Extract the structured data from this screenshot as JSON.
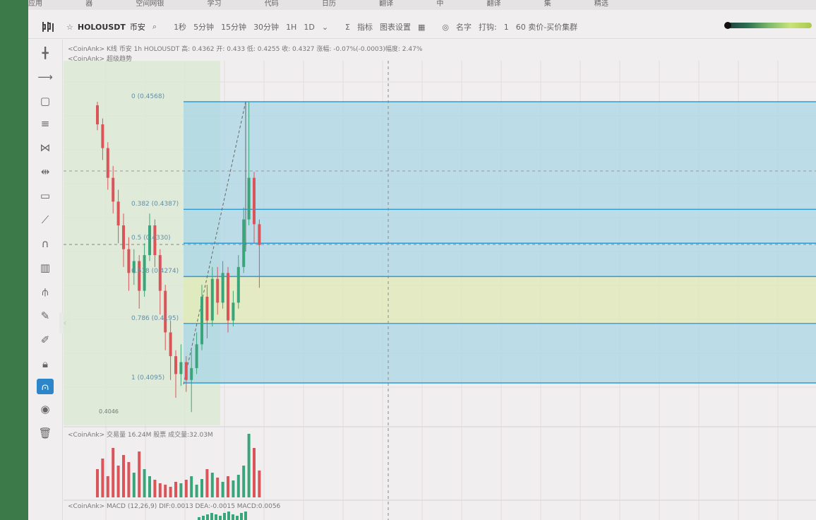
{
  "bookmarks": [
    "应用",
    "器",
    "空间网银",
    "学习",
    "代码",
    "日历",
    "翻译",
    "中",
    "翻译",
    "集",
    "精选"
  ],
  "toolbar": {
    "symbol": "HOLOUSDT",
    "market": "币安",
    "intervals": [
      "1秒",
      "5分钟",
      "15分钟",
      "30分钟",
      "1H",
      "1D"
    ],
    "indicators_label": "指标",
    "chart_settings_label": "图表设置",
    "name_label": "名字",
    "order_label": "打钩:",
    "order_value": "1",
    "price_label": "60 卖价-买价集群"
  },
  "chart_header": {
    "line1": "<CoinAnk> K线  币安 1h HOLOUSDT 高: 0.4362  开: 0.433  低: 0.4255  收: 0.4327 涨幅: -0.07%(-0.0003)幅度: 2.47%",
    "line2": "<CoinAnk> 超级趋势"
  },
  "fib_levels": [
    {
      "label": "0 (0.4568)",
      "price": 0.4568
    },
    {
      "label": "0.382 (0.4387)",
      "price": 0.4387
    },
    {
      "label": "0.5 (0.4330)",
      "price": 0.433
    },
    {
      "label": "0.618 (0.4274)",
      "price": 0.4274
    },
    {
      "label": "0.786 (0.4195)",
      "price": 0.4195
    },
    {
      "label": "1 (0.4095)",
      "price": 0.4095
    }
  ],
  "low_marker": "0.4046",
  "volume": {
    "header": "<CoinAnk> 交易量   16.24M  股票  成交量:32.03M"
  },
  "macd": {
    "header": "<CoinAnk> MACD  (12,26,9)   DIF:0.0013   DEA:-0.0015   MACD:0.0056"
  },
  "colors": {
    "up": "#3aa57a",
    "down": "#d9555a",
    "fib_blue": "#a9d6e6",
    "fib_green": "#dfe9b6",
    "fib_line": "#2f9bd6"
  },
  "tools": [
    "crosshair",
    "horizontal-ray",
    "rectangle",
    "parallel-lines",
    "xabcd",
    "price-range",
    "text-note",
    "ruler",
    "magnet",
    "bar-chart",
    "pitchfork",
    "pen",
    "brush",
    "lock",
    "fib-tool",
    "eye",
    "trash"
  ]
}
